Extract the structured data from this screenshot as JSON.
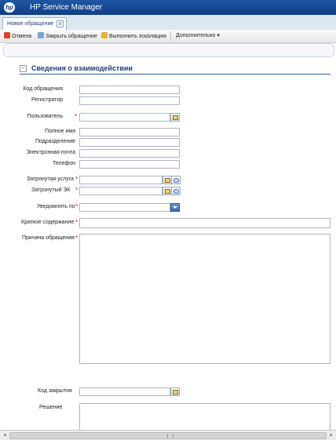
{
  "app": {
    "title": "HP Service Manager",
    "logo_text": "hp"
  },
  "tabs": [
    {
      "label": "Новое обращение",
      "close_symbol": "x"
    }
  ],
  "toolbar": {
    "cancel": "Отмена",
    "close_ticket": "Закрыть обращение",
    "escalate": "Выполнить эскалацию",
    "more": "Дополнительно",
    "more_arrow": "▾"
  },
  "section": {
    "collapse_symbol": "−",
    "title": "Сведения о взаимодействии"
  },
  "fields": {
    "ticket_id": "Код обращения",
    "registrar": "Регистратор",
    "user": "Пользователь",
    "full_name": "Полное имя",
    "department": "Подразделение",
    "email": "Электронная почта",
    "phone": "Телефон",
    "affected_service": "Затронутая услуга",
    "affected_ci": "Затронутый ЭК",
    "notify_by": "Уведомлять по",
    "summary": "Краткое содержание",
    "reason": "Причина обращения",
    "closure_code": "Код закрытия",
    "solution": "Решение"
  },
  "required_mark": "*",
  "scroll": {
    "left": "◂",
    "right": "▸"
  },
  "colors": {
    "title_bar": "#1f56a3",
    "section_title": "#1e3f75",
    "required": "#cc2222"
  }
}
